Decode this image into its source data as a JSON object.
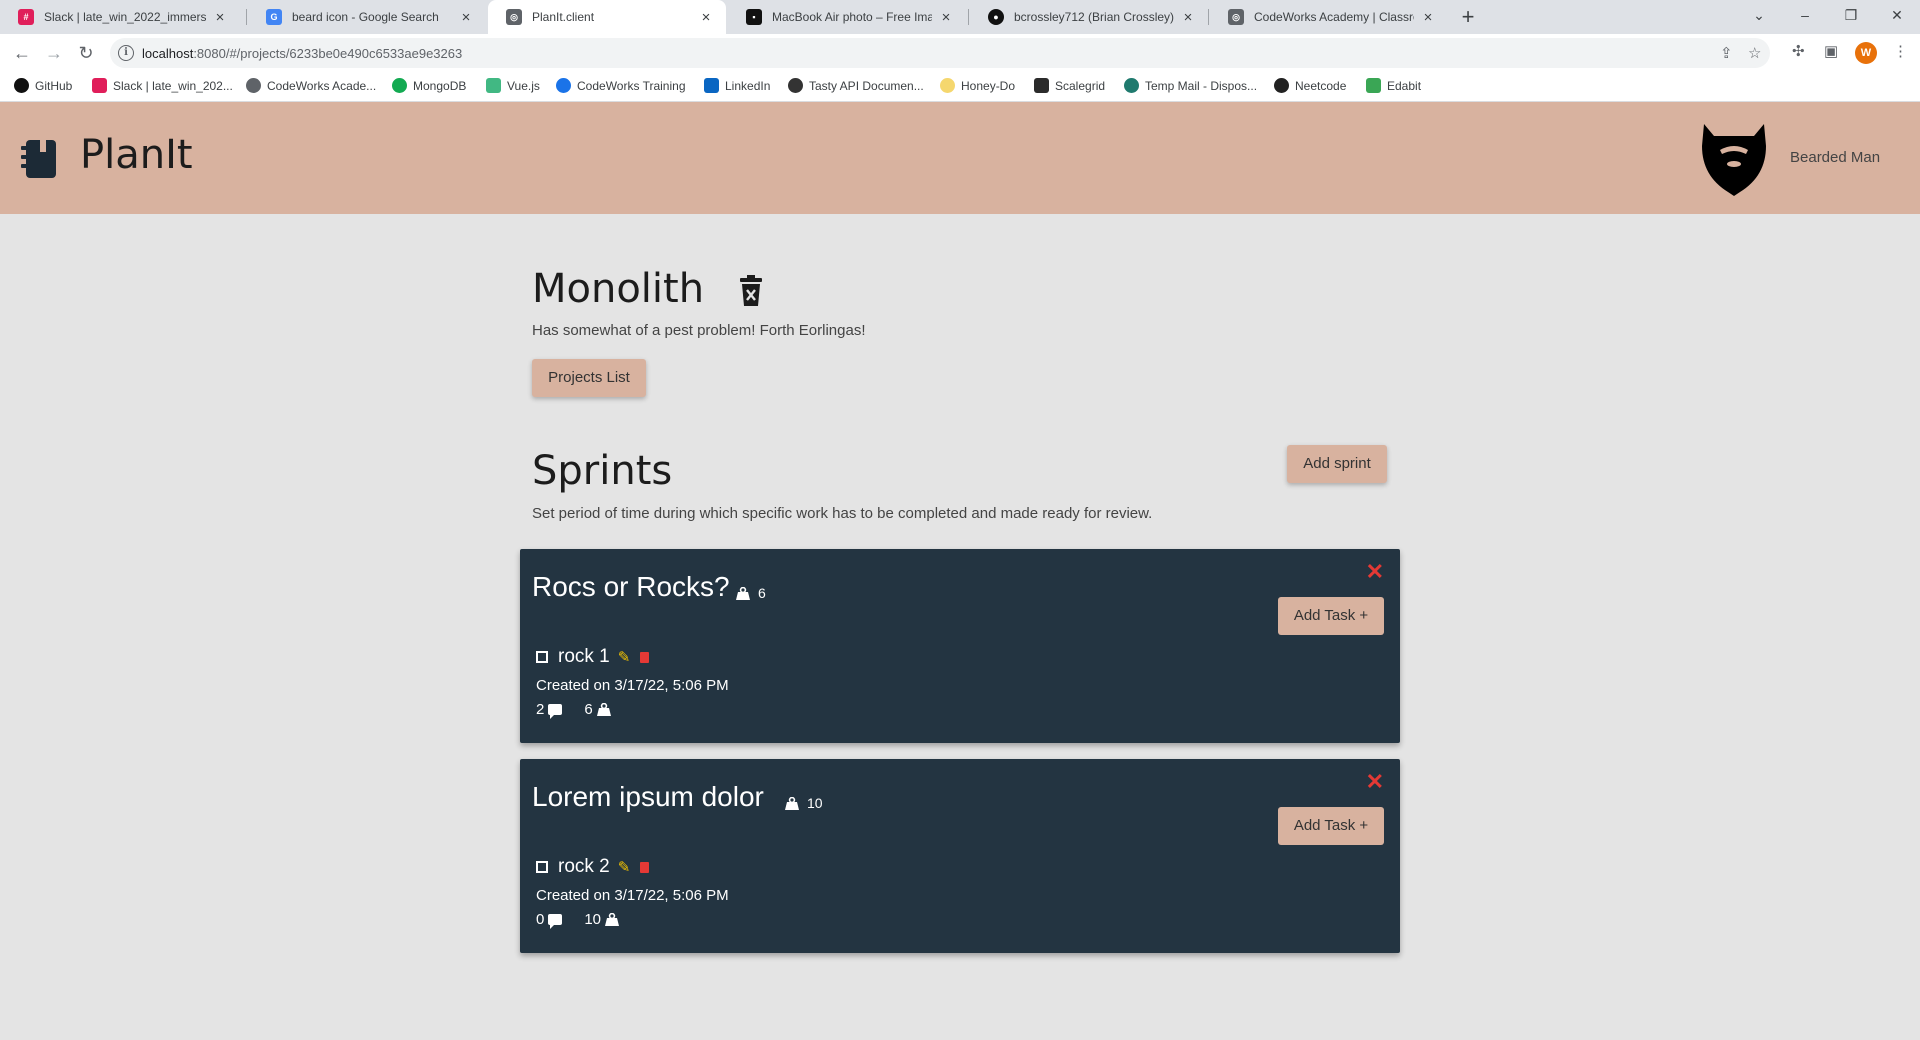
{
  "browser": {
    "tabs": [
      {
        "label": "Slack | late_win_2022_immersive",
        "fav_color": "#e01e5a",
        "fav_text": "#"
      },
      {
        "label": "beard icon - Google Search",
        "fav_color": "#4285f4",
        "fav_text": "G"
      },
      {
        "label": "PlanIt.client",
        "fav_color": "#5f6368",
        "fav_text": "◎"
      },
      {
        "label": "MacBook Air photo – Free Image",
        "fav_color": "#111111",
        "fav_text": "▪"
      },
      {
        "label": "bcrossley712 (Brian Crossley)",
        "fav_color": "#111111",
        "fav_text": "●"
      },
      {
        "label": "CodeWorks Academy | Classroom",
        "fav_color": "#5f6368",
        "fav_text": "◎"
      }
    ],
    "url_host": "localhost",
    "url_rest": ":8080/#/projects/6233be0e490c6533ae9e3263",
    "profile_initial": "W",
    "bookmarks": [
      {
        "label": "GitHub",
        "color": "#111111"
      },
      {
        "label": "Slack | late_win_202...",
        "color": "#e01e5a"
      },
      {
        "label": "CodeWorks Acade...",
        "color": "#5f6368"
      },
      {
        "label": "MongoDB",
        "color": "#13aa52"
      },
      {
        "label": "Vue.js",
        "color": "#41b883"
      },
      {
        "label": "CodeWorks Training",
        "color": "#1a73e8"
      },
      {
        "label": "LinkedIn",
        "color": "#0a66c2"
      },
      {
        "label": "Tasty API Documen...",
        "color": "#333333"
      },
      {
        "label": "Honey-Do",
        "color": "#f5d76e"
      },
      {
        "label": "Scalegrid",
        "color": "#2b2b2b"
      },
      {
        "label": "Temp Mail - Dispos...",
        "color": "#1f7a6e"
      },
      {
        "label": "Neetcode",
        "color": "#222222"
      },
      {
        "label": "Edabit",
        "color": "#3aa655"
      }
    ]
  },
  "app": {
    "brand": "PlanIt",
    "user_name": "Bearded Man",
    "colors": {
      "header": "#d8b29f",
      "card": "#233441",
      "danger": "#e53935",
      "accent": "#f2c200"
    }
  },
  "project": {
    "title": "Monolith",
    "description": "Has somewhat of a pest problem! Forth Eorlingas!",
    "projects_list_label": "Projects List"
  },
  "sprints_section": {
    "title": "Sprints",
    "add_sprint_label": "Add sprint",
    "description": "Set period of time during which specific work has to be completed and made ready for review."
  },
  "sprints": [
    {
      "name": "Rocs or Rocks?",
      "weight": "6",
      "close_label": "✕",
      "add_task_label": "Add Task +",
      "task": {
        "name": "rock 1",
        "created": "Created on 3/17/22, 5:06 PM",
        "notes": "2",
        "weight": "6"
      }
    },
    {
      "name": "Lorem ipsum dolor",
      "weight": "10",
      "close_label": "✕",
      "add_task_label": "Add Task +",
      "task": {
        "name": "rock 2",
        "created": "Created on 3/17/22, 5:06 PM",
        "notes": "0",
        "weight": "10"
      }
    }
  ]
}
